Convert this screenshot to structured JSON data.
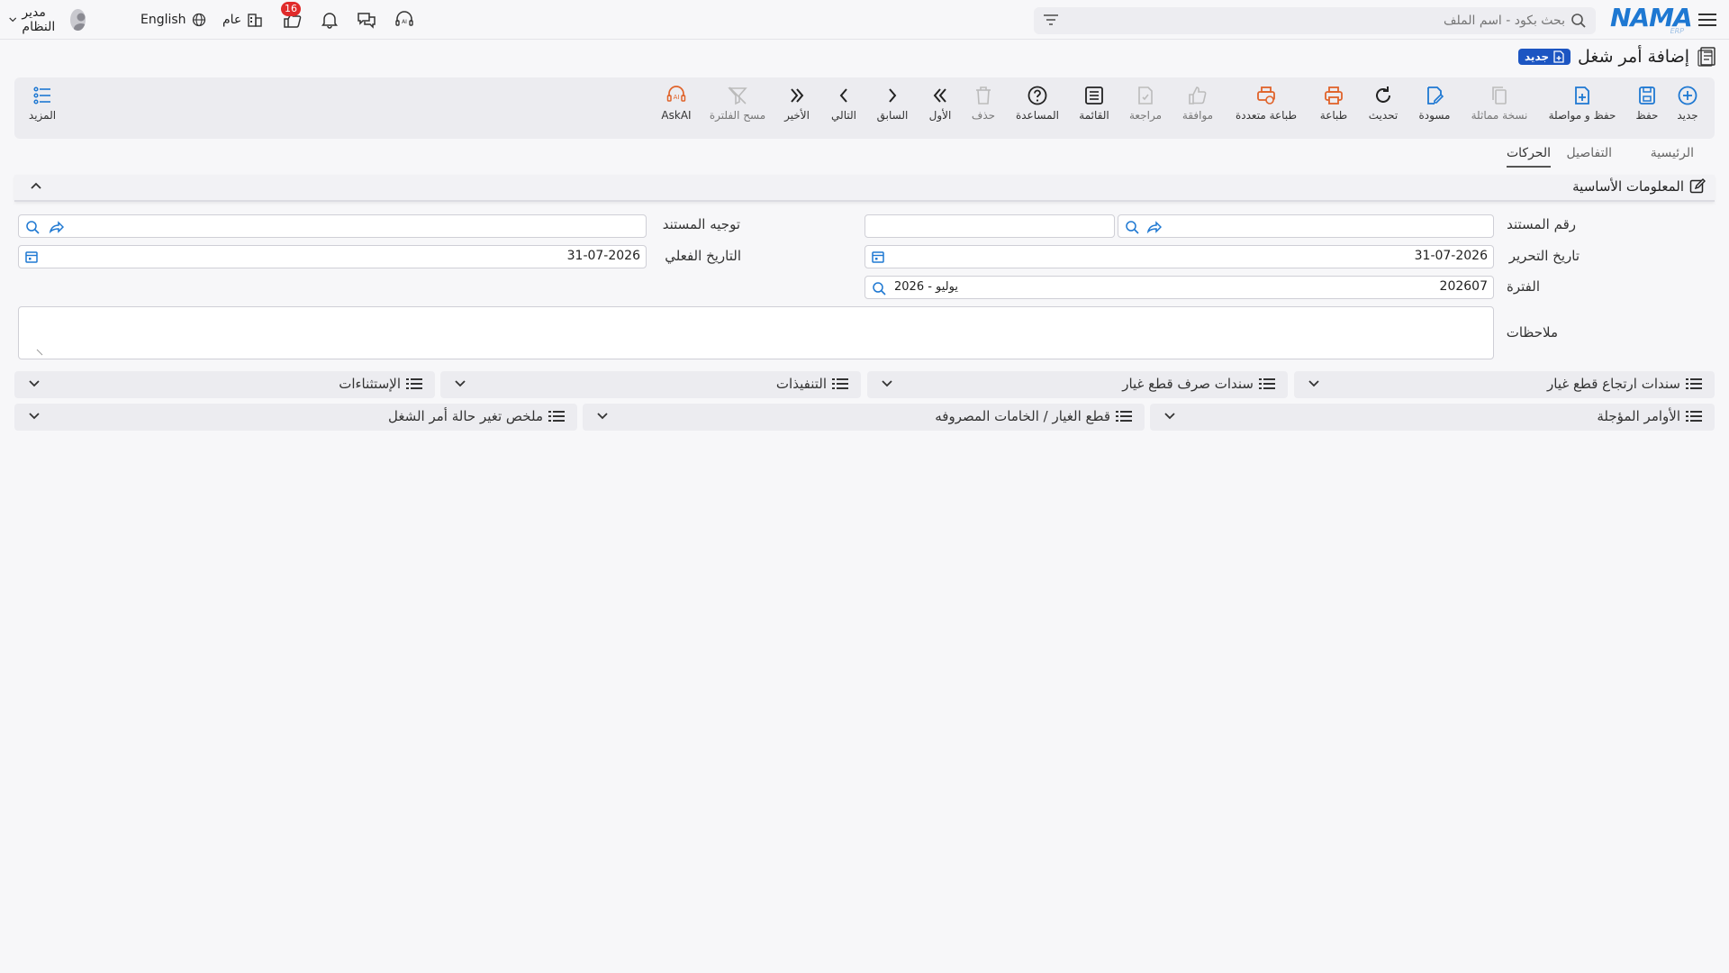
{
  "topbar": {
    "logo": "NAMA",
    "logo_sub": "ERP",
    "search_placeholder": "بحث بكود - اسم الملف",
    "user_name": "مدير النظام",
    "language": "English",
    "branch": "عام",
    "notifications_count": "16"
  },
  "page": {
    "title": "إضافة أمر شغل",
    "status_badge": "جديد"
  },
  "toolbar": {
    "new": "جديد",
    "save": "حفظ",
    "save_continue": "حفظ و مواصلة",
    "duplicate": "نسخة مماثلة",
    "draft": "مسودة",
    "refresh": "تحديث",
    "print": "طباعة",
    "multi_print": "طباعة متعددة",
    "approve": "موافقة",
    "review": "مراجعة",
    "list": "القائمة",
    "help": "المساعدة",
    "delete": "حذف",
    "first": "الأول",
    "previous": "السابق",
    "next": "التالي",
    "last": "الأخير",
    "clear_filter": "مسح الفلترة",
    "askai": "AskAI",
    "more": "المزيد"
  },
  "tabs": [
    "الرئيسية",
    "التفاصيل",
    "الحركات"
  ],
  "section": {
    "title": "المعلومات الأساسية"
  },
  "form": {
    "doc_number_label": "رقم المستند",
    "doc_number_value": "",
    "doc_direction_label": "توجيه المستند",
    "edit_date_label": "تاريخ التحرير",
    "edit_date_value": "31-07-2026",
    "actual_date_label": "التاريخ الفعلي",
    "actual_date_value": "31-07-2026",
    "period_label": "الفترة",
    "period_code": "202607",
    "period_name": "2026 - يوليو",
    "notes_label": "ملاحظات"
  },
  "groups": [
    "سندات ارتجاع قطع غيار",
    "سندات صرف قطع غيار",
    "التنفيذات",
    "الإستثناءات",
    "الأوامر المؤجلة",
    "قطع الغيار / الخامات المصروفه",
    "ملخص تغير حالة أمر الشغل"
  ],
  "colors": {
    "accent_blue": "#1e78d2",
    "badge_blue": "#1c55c2",
    "print_orange": "#e0632a",
    "notify_red": "#e02b2b"
  }
}
